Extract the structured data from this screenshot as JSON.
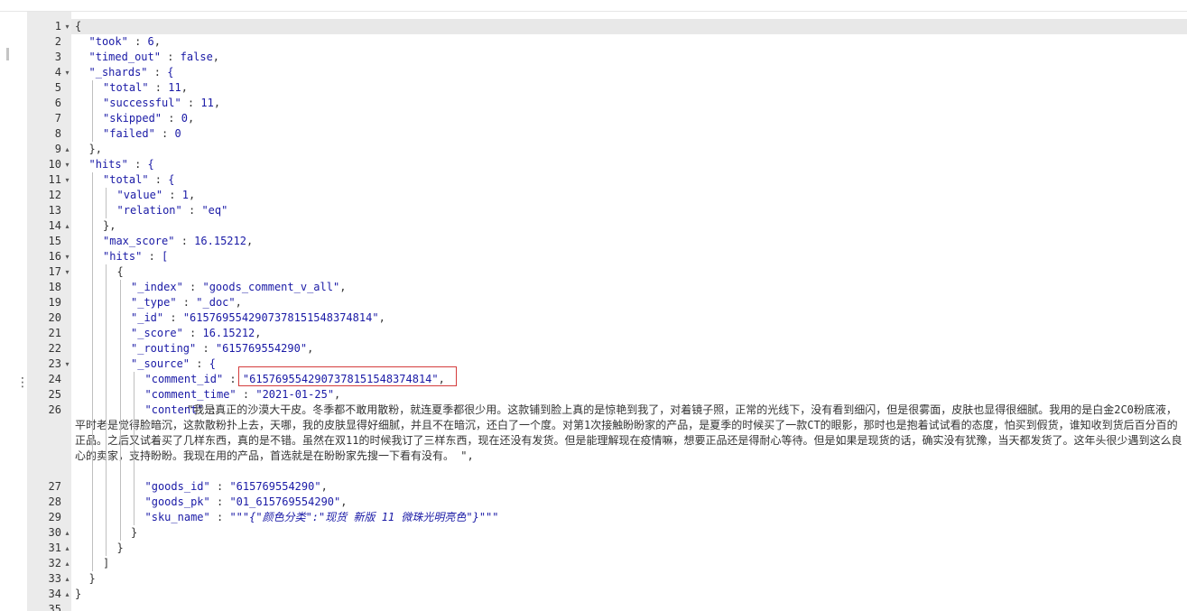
{
  "editor": {
    "lines": [
      {
        "n": "1",
        "fold": "▾",
        "indent": 0,
        "text": "{"
      },
      {
        "n": "2",
        "fold": "",
        "indent": 1,
        "key": "\"took\"",
        "sep": " : ",
        "val": "6",
        "trail": ","
      },
      {
        "n": "3",
        "fold": "",
        "indent": 1,
        "key": "\"timed_out\"",
        "sep": " : ",
        "val": "false",
        "trail": ","
      },
      {
        "n": "4",
        "fold": "▾",
        "indent": 1,
        "key": "\"_shards\"",
        "sep": " : ",
        "val": "{",
        "trail": ""
      },
      {
        "n": "5",
        "fold": "",
        "indent": 2,
        "key": "\"total\"",
        "sep": " : ",
        "val": "11",
        "trail": ","
      },
      {
        "n": "6",
        "fold": "",
        "indent": 2,
        "key": "\"successful\"",
        "sep": " : ",
        "val": "11",
        "trail": ","
      },
      {
        "n": "7",
        "fold": "",
        "indent": 2,
        "key": "\"skipped\"",
        "sep": " : ",
        "val": "0",
        "trail": ","
      },
      {
        "n": "8",
        "fold": "",
        "indent": 2,
        "key": "\"failed\"",
        "sep": " : ",
        "val": "0",
        "trail": ""
      },
      {
        "n": "9",
        "fold": "▴",
        "indent": 1,
        "text": "},"
      },
      {
        "n": "10",
        "fold": "▾",
        "indent": 1,
        "key": "\"hits\"",
        "sep": " : ",
        "val": "{",
        "trail": ""
      },
      {
        "n": "11",
        "fold": "▾",
        "indent": 2,
        "key": "\"total\"",
        "sep": " : ",
        "val": "{",
        "trail": ""
      },
      {
        "n": "12",
        "fold": "",
        "indent": 3,
        "key": "\"value\"",
        "sep": " : ",
        "val": "1",
        "trail": ","
      },
      {
        "n": "13",
        "fold": "",
        "indent": 3,
        "key": "\"relation\"",
        "sep": " : ",
        "val": "\"eq\"",
        "trail": ""
      },
      {
        "n": "14",
        "fold": "▴",
        "indent": 2,
        "text": "},"
      },
      {
        "n": "15",
        "fold": "",
        "indent": 2,
        "key": "\"max_score\"",
        "sep": " : ",
        "val": "16.15212",
        "trail": ","
      },
      {
        "n": "16",
        "fold": "▾",
        "indent": 2,
        "key": "\"hits\"",
        "sep": " : ",
        "val": "[",
        "trail": ""
      },
      {
        "n": "17",
        "fold": "▾",
        "indent": 3,
        "text": "{"
      },
      {
        "n": "18",
        "fold": "",
        "indent": 4,
        "key": "\"_index\"",
        "sep": " : ",
        "val": "\"goods_comment_v_all\"",
        "trail": ","
      },
      {
        "n": "19",
        "fold": "",
        "indent": 4,
        "key": "\"_type\"",
        "sep": " : ",
        "val": "\"_doc\"",
        "trail": ","
      },
      {
        "n": "20",
        "fold": "",
        "indent": 4,
        "key": "\"_id\"",
        "sep": " : ",
        "val": "\"6157695542907378151548374814\"",
        "trail": ","
      },
      {
        "n": "21",
        "fold": "",
        "indent": 4,
        "key": "\"_score\"",
        "sep": " : ",
        "val": "16.15212",
        "trail": ","
      },
      {
        "n": "22",
        "fold": "",
        "indent": 4,
        "key": "\"_routing\"",
        "sep": " : ",
        "val": "\"615769554290\"",
        "trail": ","
      },
      {
        "n": "23",
        "fold": "▾",
        "indent": 4,
        "key": "\"_source\"",
        "sep": " : ",
        "val": "{",
        "trail": ""
      },
      {
        "n": "24",
        "fold": "",
        "indent": 5,
        "key": "\"comment_id\"",
        "sep": " : ",
        "val": "\"6157695542907378151548374814\"",
        "trail": ","
      },
      {
        "n": "25",
        "fold": "",
        "indent": 5,
        "key": "\"comment_time\"",
        "sep": " : ",
        "val": "\"2021-01-25\"",
        "trail": ","
      },
      {
        "n": "26",
        "fold": "",
        "indent": 5,
        "key": "\"content\"",
        "sep": " : ",
        "val": "",
        "trail": ""
      },
      {
        "n": "27",
        "fold": "",
        "indent": 5,
        "key": "\"goods_id\"",
        "sep": " : ",
        "val": "\"615769554290\"",
        "trail": ","
      },
      {
        "n": "28",
        "fold": "",
        "indent": 5,
        "key": "\"goods_pk\"",
        "sep": " : ",
        "val": "\"01_615769554290\"",
        "trail": ","
      },
      {
        "n": "29",
        "fold": "",
        "indent": 5,
        "key": "\"sku_name\"",
        "sep": " : ",
        "val": "\"\"\"",
        "trail": ""
      },
      {
        "n": "30",
        "fold": "▴",
        "indent": 4,
        "text": "}"
      },
      {
        "n": "31",
        "fold": "▴",
        "indent": 3,
        "text": "}"
      },
      {
        "n": "32",
        "fold": "▴",
        "indent": 2,
        "text": "]"
      },
      {
        "n": "33",
        "fold": "▴",
        "indent": 1,
        "text": "}"
      },
      {
        "n": "34",
        "fold": "▴",
        "indent": 0,
        "text": "}"
      },
      {
        "n": "35",
        "fold": "",
        "indent": 0,
        "text": ""
      }
    ],
    "content_value": "\"我是真正的沙漠大干皮。冬季都不敢用散粉，就连夏季都很少用。这款铺到脸上真的是惊艳到我了，对着镜子照，正常的光线下，没有看到细闪，但是很雾面，皮肤也显得很细腻。我用的是白金2C0粉底液，平时老是觉得脸暗沉，这款散粉扑上去，天哪，我的皮肤显得好细腻，并且不在暗沉，还白了一个度。对第1次接触盼盼家的产品，是夏季的时候买了一款CT的眼影，那时也是抱着试试看的态度，怕买到假货，谁知收到货后百分百的正品。之后又试着买了几样东西，真的是不错。虽然在双11的时候我订了三样东西，现在还没有发货。但是能理解现在疫情嘛，想要正品还是得耐心等待。但是如果是现货的话，确实没有犹豫，当天都发货了。这年头很少遇到这么良心的卖家，支持盼盼。我现在用的产品，首选就是在盼盼家先搜一下看有没有。 \",",
    "sku_name_inner": "{\"颜色分类\":\"现货 新版 11 微珠光明亮色\"}",
    "sku_name_close": "\"\"\""
  },
  "colors": {
    "accent": "#1a1aa6",
    "highlight_border": "#d43c3c",
    "gutter_bg": "#ebebeb"
  }
}
